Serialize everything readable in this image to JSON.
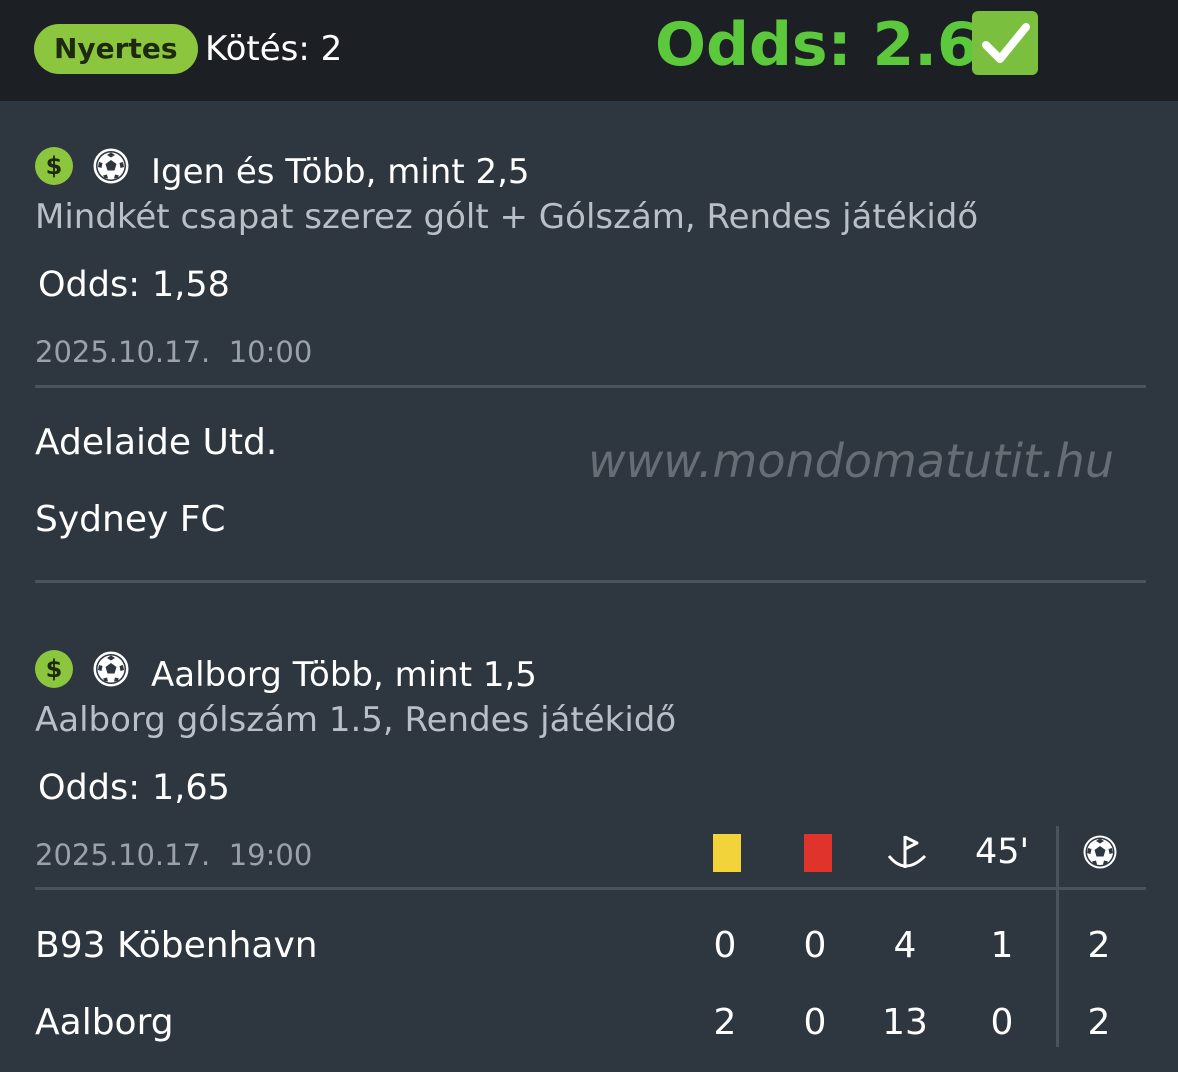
{
  "header": {
    "status": "Nyertes",
    "bet_count": "Kötés: 2",
    "total_odds": "Odds: 2.60",
    "check_icon": "check-mark-button-icon"
  },
  "selections": [
    {
      "title": "Igen és Több, mint 2,5",
      "subtitle": "Mindkét csapat szerez gólt + Gólszám, Rendes játékidő",
      "odds_label": "Odds:",
      "odds_value": "1,58",
      "date": "2025.10.17.",
      "time": "10:00",
      "home_team": "Adelaide Utd.",
      "away_team": "Sydney FC"
    },
    {
      "title": "Aalborg Több, mint 1,5",
      "subtitle": "Aalborg gólszám 1.5, Rendes játékidő",
      "odds_label": "Odds:",
      "odds_value": "1,65",
      "date": "2025.10.17.",
      "time": "19:00",
      "stats_header": {
        "yellow_card_icon": "yellow-card-icon",
        "red_card_icon": "red-card-icon",
        "corner_icon": "corner-flag-icon",
        "half_time": "45'",
        "goals_icon": "soccer-ball-icon"
      },
      "rows": [
        {
          "team": "B93 Köbenhavn",
          "yellow": "0",
          "red": "0",
          "corners": "4",
          "half": "1",
          "goals": "2"
        },
        {
          "team": "Aalborg",
          "yellow": "2",
          "red": "0",
          "corners": "13",
          "half": "0",
          "goals": "2"
        }
      ]
    }
  ],
  "watermark": "www.mondomatutit.hu",
  "colors": {
    "accent_green": "#8cc63f",
    "odds_green": "#5cc83c",
    "background": "#2e3640",
    "header_bg": "#1c1f23"
  }
}
